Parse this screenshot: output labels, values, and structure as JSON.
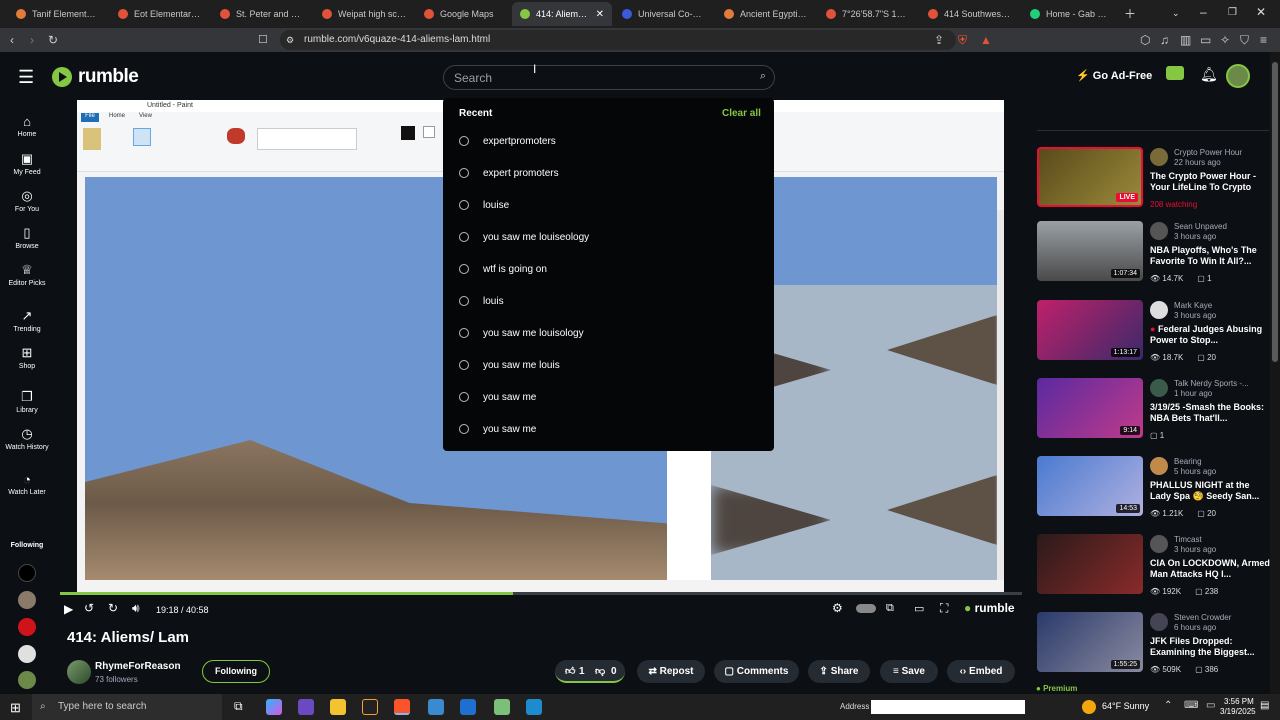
{
  "browser": {
    "tabs": [
      {
        "label": "Tanif Elementary Sc",
        "color": "#e07b39"
      },
      {
        "label": "Eot Elementary - Go",
        "color": "#e0533a"
      },
      {
        "label": "St. Peter and St. Pa",
        "color": "#e0533a"
      },
      {
        "label": "Weipat high school",
        "color": "#e0533a"
      },
      {
        "label": "Google Maps",
        "color": "#e0533a"
      },
      {
        "label": "414: Aliems/ La",
        "color": "#85c742",
        "active": true
      },
      {
        "label": "Universal Co-Maso",
        "color": "#3b5bdb"
      },
      {
        "label": "Ancient Egyptian Lo",
        "color": "#e07b39"
      },
      {
        "label": "7°26'58.7\"S 13°51'3",
        "color": "#e0533a"
      },
      {
        "label": "414 Southwest 84th",
        "color": "#e0533a"
      },
      {
        "label": "Home - Gab Social",
        "color": "#21cf7a"
      }
    ],
    "url": "rumble.com/v6quaze-414-aliems-lam.html"
  },
  "header": {
    "logo_text": "rumble",
    "search_placeholder": "Search",
    "go_ad_free": "Go Ad-Free"
  },
  "leftnav": {
    "items": [
      {
        "label": "Home",
        "icon": "home-icon"
      },
      {
        "label": "My Feed",
        "icon": "feed-icon"
      },
      {
        "label": "For You",
        "icon": "target-icon"
      },
      {
        "label": "Browse",
        "icon": "browse-icon"
      },
      {
        "label": "Editor Picks",
        "icon": "award-icon"
      },
      {
        "label": "Trending",
        "icon": "trending-icon"
      },
      {
        "label": "Shop",
        "icon": "shop-icon"
      },
      {
        "label": "Library",
        "icon": "library-icon"
      },
      {
        "label": "Watch History",
        "icon": "history-icon"
      },
      {
        "label": "Watch Later",
        "icon": "clock-icon"
      }
    ],
    "following_label": "Following"
  },
  "dropdown": {
    "recent_label": "Recent",
    "clear_label": "Clear all",
    "items": [
      "expertpromoters",
      "expert promoters",
      "louise",
      "you saw me louiseology",
      "wtf is going on",
      "louis",
      "you saw me louisology",
      "you saw me louis",
      "you saw me",
      "you saw me"
    ]
  },
  "paint": {
    "title": "Untitled - Paint",
    "tabs": [
      "File",
      "Home",
      "View"
    ]
  },
  "player": {
    "time": "19:18 / 40:58",
    "progress_fraction": 0.471,
    "brand": "rumble"
  },
  "video": {
    "title": "414: Aliems/ Lam",
    "channel": "RhymeForReason",
    "followers": "73 followers",
    "following_label": "Following",
    "likes": "1",
    "dislikes": "0",
    "repost": "Repost",
    "comments": "Comments",
    "share": "Share",
    "save": "Save",
    "embed": "Embed"
  },
  "sidebar": {
    "recs": [
      {
        "channel": "Crypto Power Hour",
        "ago": "22 hours ago",
        "title": "The Crypto Power Hour - Your LifeLine To Crypto",
        "meta": "208 watching",
        "badge": "LIVE",
        "live": true,
        "thumb": "#7a6a2a"
      },
      {
        "channel": "Sean Unpaved",
        "ago": "3 hours ago",
        "title": "NBA Playoffs, Who's The Favorite To Win It All?...",
        "views": "14.7K",
        "comments": "1",
        "badge": "1:07:34",
        "thumb": "#6a6a6a"
      },
      {
        "channel": "Mark Kaye",
        "ago": "3 hours ago",
        "title": "Federal Judges Abusing Power to Stop...",
        "views": "18.7K",
        "comments": "20",
        "badge": "1:13:17",
        "thumb": "#8a2a6a"
      },
      {
        "channel": "Talk Nerdy Sports -...",
        "ago": "1 hour ago",
        "title": "3/19/25 -Smash the Books: NBA Bets That'll...",
        "views": "",
        "comments": "1",
        "badge": "9:14",
        "thumb": "#4a2a8a"
      },
      {
        "channel": "Bearing",
        "ago": "5 hours ago",
        "title": "PHALLUS NIGHT at the Lady Spa 🧐 Seedy San...",
        "views": "1.21K",
        "comments": "20",
        "badge": "14:53",
        "thumb": "#5a7ab8"
      },
      {
        "channel": "Timcast",
        "ago": "3 hours ago",
        "title": "CIA On LOCKDOWN, Armed Man Attacks HQ I...",
        "views": "192K",
        "comments": "238",
        "badge": "",
        "thumb": "#3a2a2a"
      },
      {
        "channel": "Steven Crowder",
        "ago": "6 hours ago",
        "title": "JFK Files Dropped: Examining the Biggest...",
        "views": "509K",
        "comments": "386",
        "badge": "1:55:25",
        "thumb": "#3a4a6a"
      }
    ],
    "premium_label": "Premium"
  },
  "taskbar": {
    "search_text": "Type here to search",
    "address_label": "Address",
    "weather": "64°F  Sunny",
    "time": "3:56 PM",
    "date": "3/19/2025"
  }
}
